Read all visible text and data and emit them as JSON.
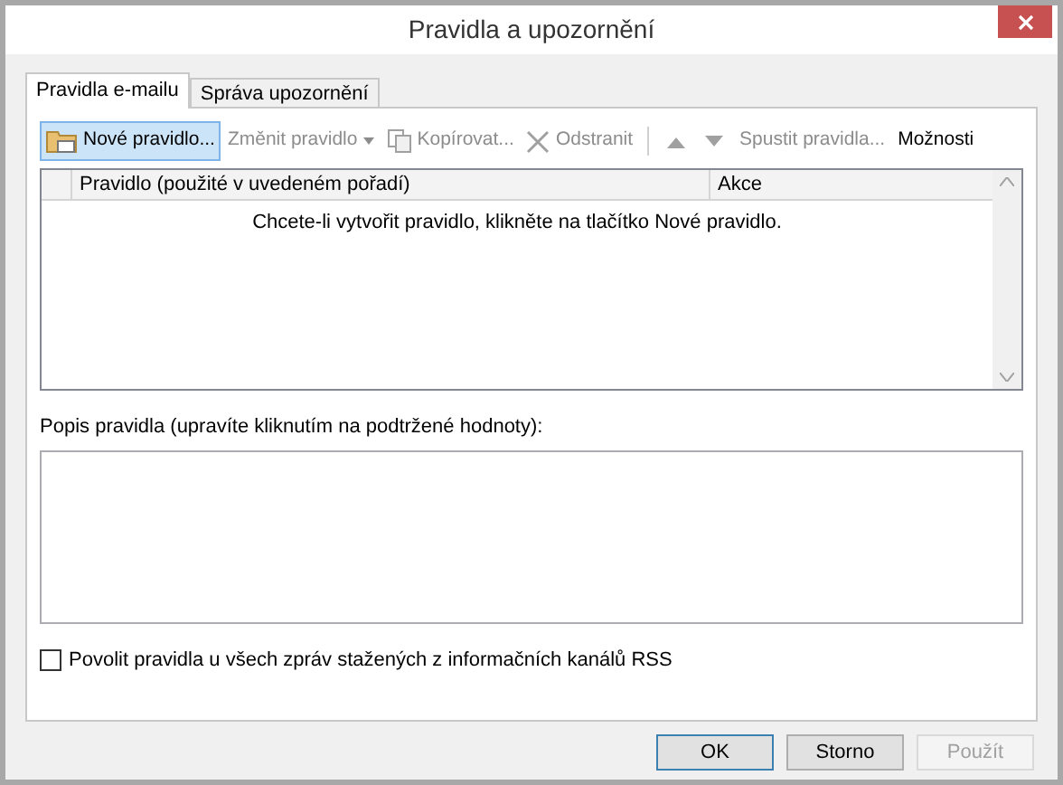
{
  "window": {
    "title": "Pravidla a upozornění"
  },
  "tabs": [
    {
      "label": "Pravidla e-mailu",
      "selected": true
    },
    {
      "label": "Správa upozornění",
      "selected": false
    }
  ],
  "toolbar": [
    {
      "kind": "new",
      "label": "Nové pravidlo...",
      "disabled": false,
      "selected": true
    },
    {
      "kind": "dropdown",
      "label": "Změnit pravidlo",
      "disabled": true,
      "selected": false
    },
    {
      "kind": "copy",
      "label": "Kopírovat...",
      "disabled": true,
      "selected": false
    },
    {
      "kind": "delete",
      "label": "Odstranit",
      "disabled": true,
      "selected": false
    },
    {
      "kind": "separator"
    },
    {
      "kind": "up",
      "disabled": true
    },
    {
      "kind": "down",
      "disabled": true
    },
    {
      "kind": "text",
      "label": "Spustit pravidla...",
      "disabled": true,
      "selected": false
    },
    {
      "kind": "text",
      "label": "Možnosti",
      "disabled": false,
      "selected": false
    }
  ],
  "table": {
    "columns": [
      "Pravidlo (použité v uvedeném pořadí)",
      "Akce"
    ],
    "empty_message": "Chcete-li vytvořit pravidlo, klikněte na tlačítko Nové pravidlo."
  },
  "description": {
    "label": "Popis pravidla (upravíte kliknutím na podtržené hodnoty):"
  },
  "rss_checkbox": {
    "label": "Povolit pravidla u všech zpráv stažených z informačních kanálů RSS",
    "checked": false
  },
  "buttons": [
    {
      "label": "OK",
      "disabled": false,
      "default": true
    },
    {
      "label": "Storno",
      "disabled": false,
      "default": false
    },
    {
      "label": "Použít",
      "disabled": true,
      "default": false
    }
  ]
}
